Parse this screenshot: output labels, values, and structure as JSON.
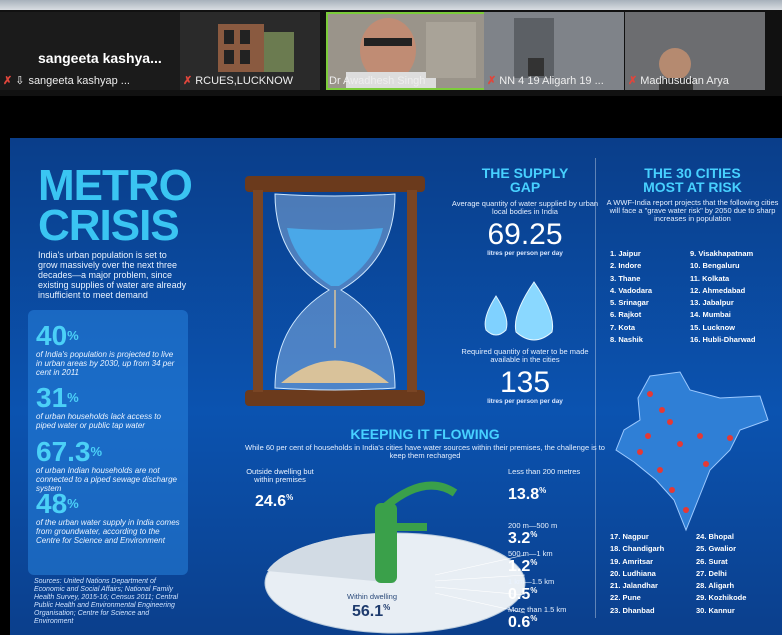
{
  "meeting": {
    "participants": [
      {
        "name": "sangeeta kashyap ...",
        "big_label": "sangeeta kashya...",
        "muted": true
      },
      {
        "name": "RCUES,LUCKNOW",
        "muted": true
      },
      {
        "name": "Dr Awadhesh Singh",
        "muted": false,
        "speaking": true
      },
      {
        "name": "NN 4 19 Aligarh 19 ...",
        "muted": true
      },
      {
        "name": "Madhusudan Arya",
        "muted": true
      }
    ]
  },
  "slide": {
    "title_line1": "METRO",
    "title_line2": "CRISIS",
    "intro": "India's urban population is set to grow massively over the next three decades—a major problem, since existing supplies of water are already insufficient to meet demand",
    "stats": [
      {
        "num": "40",
        "sup": "%",
        "text": "of India's population is projected to live in urban areas by 2030, up from 34 per cent in 2011"
      },
      {
        "num": "31",
        "sup": "%",
        "text": "of urban households lack access to piped water or public tap water"
      },
      {
        "num": "67.3",
        "sup": "%",
        "text": "of urban Indian households are not connected to a piped sewage discharge system"
      },
      {
        "num": "48",
        "sup": "%",
        "text": "of the urban water supply in India comes from groundwater, according to the Centre for Science and Environment"
      }
    ],
    "sources": "Sources: United Nations Department of Economic and Social Affairs; National Family Health Survey, 2015-16; Census 2011; Central Public Health and Environmental Engineering Organisation; Centre for Science and Environment",
    "supply": {
      "heading_line1": "THE SUPPLY",
      "heading_line2": "GAP",
      "desc": "Average quantity of water supplied by urban local bodies in India",
      "value1": "69.25",
      "unit1": "litres per person per day",
      "req_desc": "Required quantity of water to be made available in the cities",
      "value2": "135",
      "unit2": "litres per person per day"
    },
    "cities": {
      "heading_line1": "THE 30 CITIES",
      "heading_line2": "MOST AT RISK",
      "desc": "A WWF-India report projects that the following cities will face a \"grave water risk\" by 2050 due to sharp increases in population",
      "list_a": [
        "1. Jaipur",
        "2. Indore",
        "3. Thane",
        "4. Vadodara",
        "5. Srinagar",
        "6. Rajkot",
        "7. Kota",
        "8. Nashik"
      ],
      "list_b": [
        "9. Visakhapatnam",
        "10. Bengaluru",
        "11. Kolkata",
        "12. Ahmedabad",
        "13. Jabalpur",
        "14. Mumbai",
        "15. Lucknow",
        "16. Hubli-Dharwad"
      ],
      "list_c": [
        "17. Nagpur",
        "18. Chandigarh",
        "19. Amritsar",
        "20. Ludhiana",
        "21. Jalandhar",
        "22. Pune",
        "23. Dhanbad"
      ],
      "list_d": [
        "24. Bhopal",
        "25. Gwalior",
        "26. Surat",
        "27. Delhi",
        "28. Aligarh",
        "29. Kozhikode",
        "30. Kannur"
      ]
    },
    "flowing": {
      "heading": "KEEPING IT FLOWING",
      "desc": "While 60 per cent of households in India's cities have water sources within their premises, the challenge is to keep them recharged",
      "outside_label": "Outside dwelling but within premises",
      "outside_value": "24.6",
      "within_label": "Within dwelling",
      "within_value": "56.1",
      "items": [
        {
          "label": "Less than 200 metres",
          "value": "13.8"
        },
        {
          "label": "200 m—500 m",
          "value": "3.2"
        },
        {
          "label": "500 m—1 km",
          "value": "1.2"
        },
        {
          "label": "1 km—1.5 km",
          "value": "0.5"
        },
        {
          "label": "More than 1.5 km",
          "value": "0.6"
        }
      ],
      "pct": "%"
    }
  }
}
